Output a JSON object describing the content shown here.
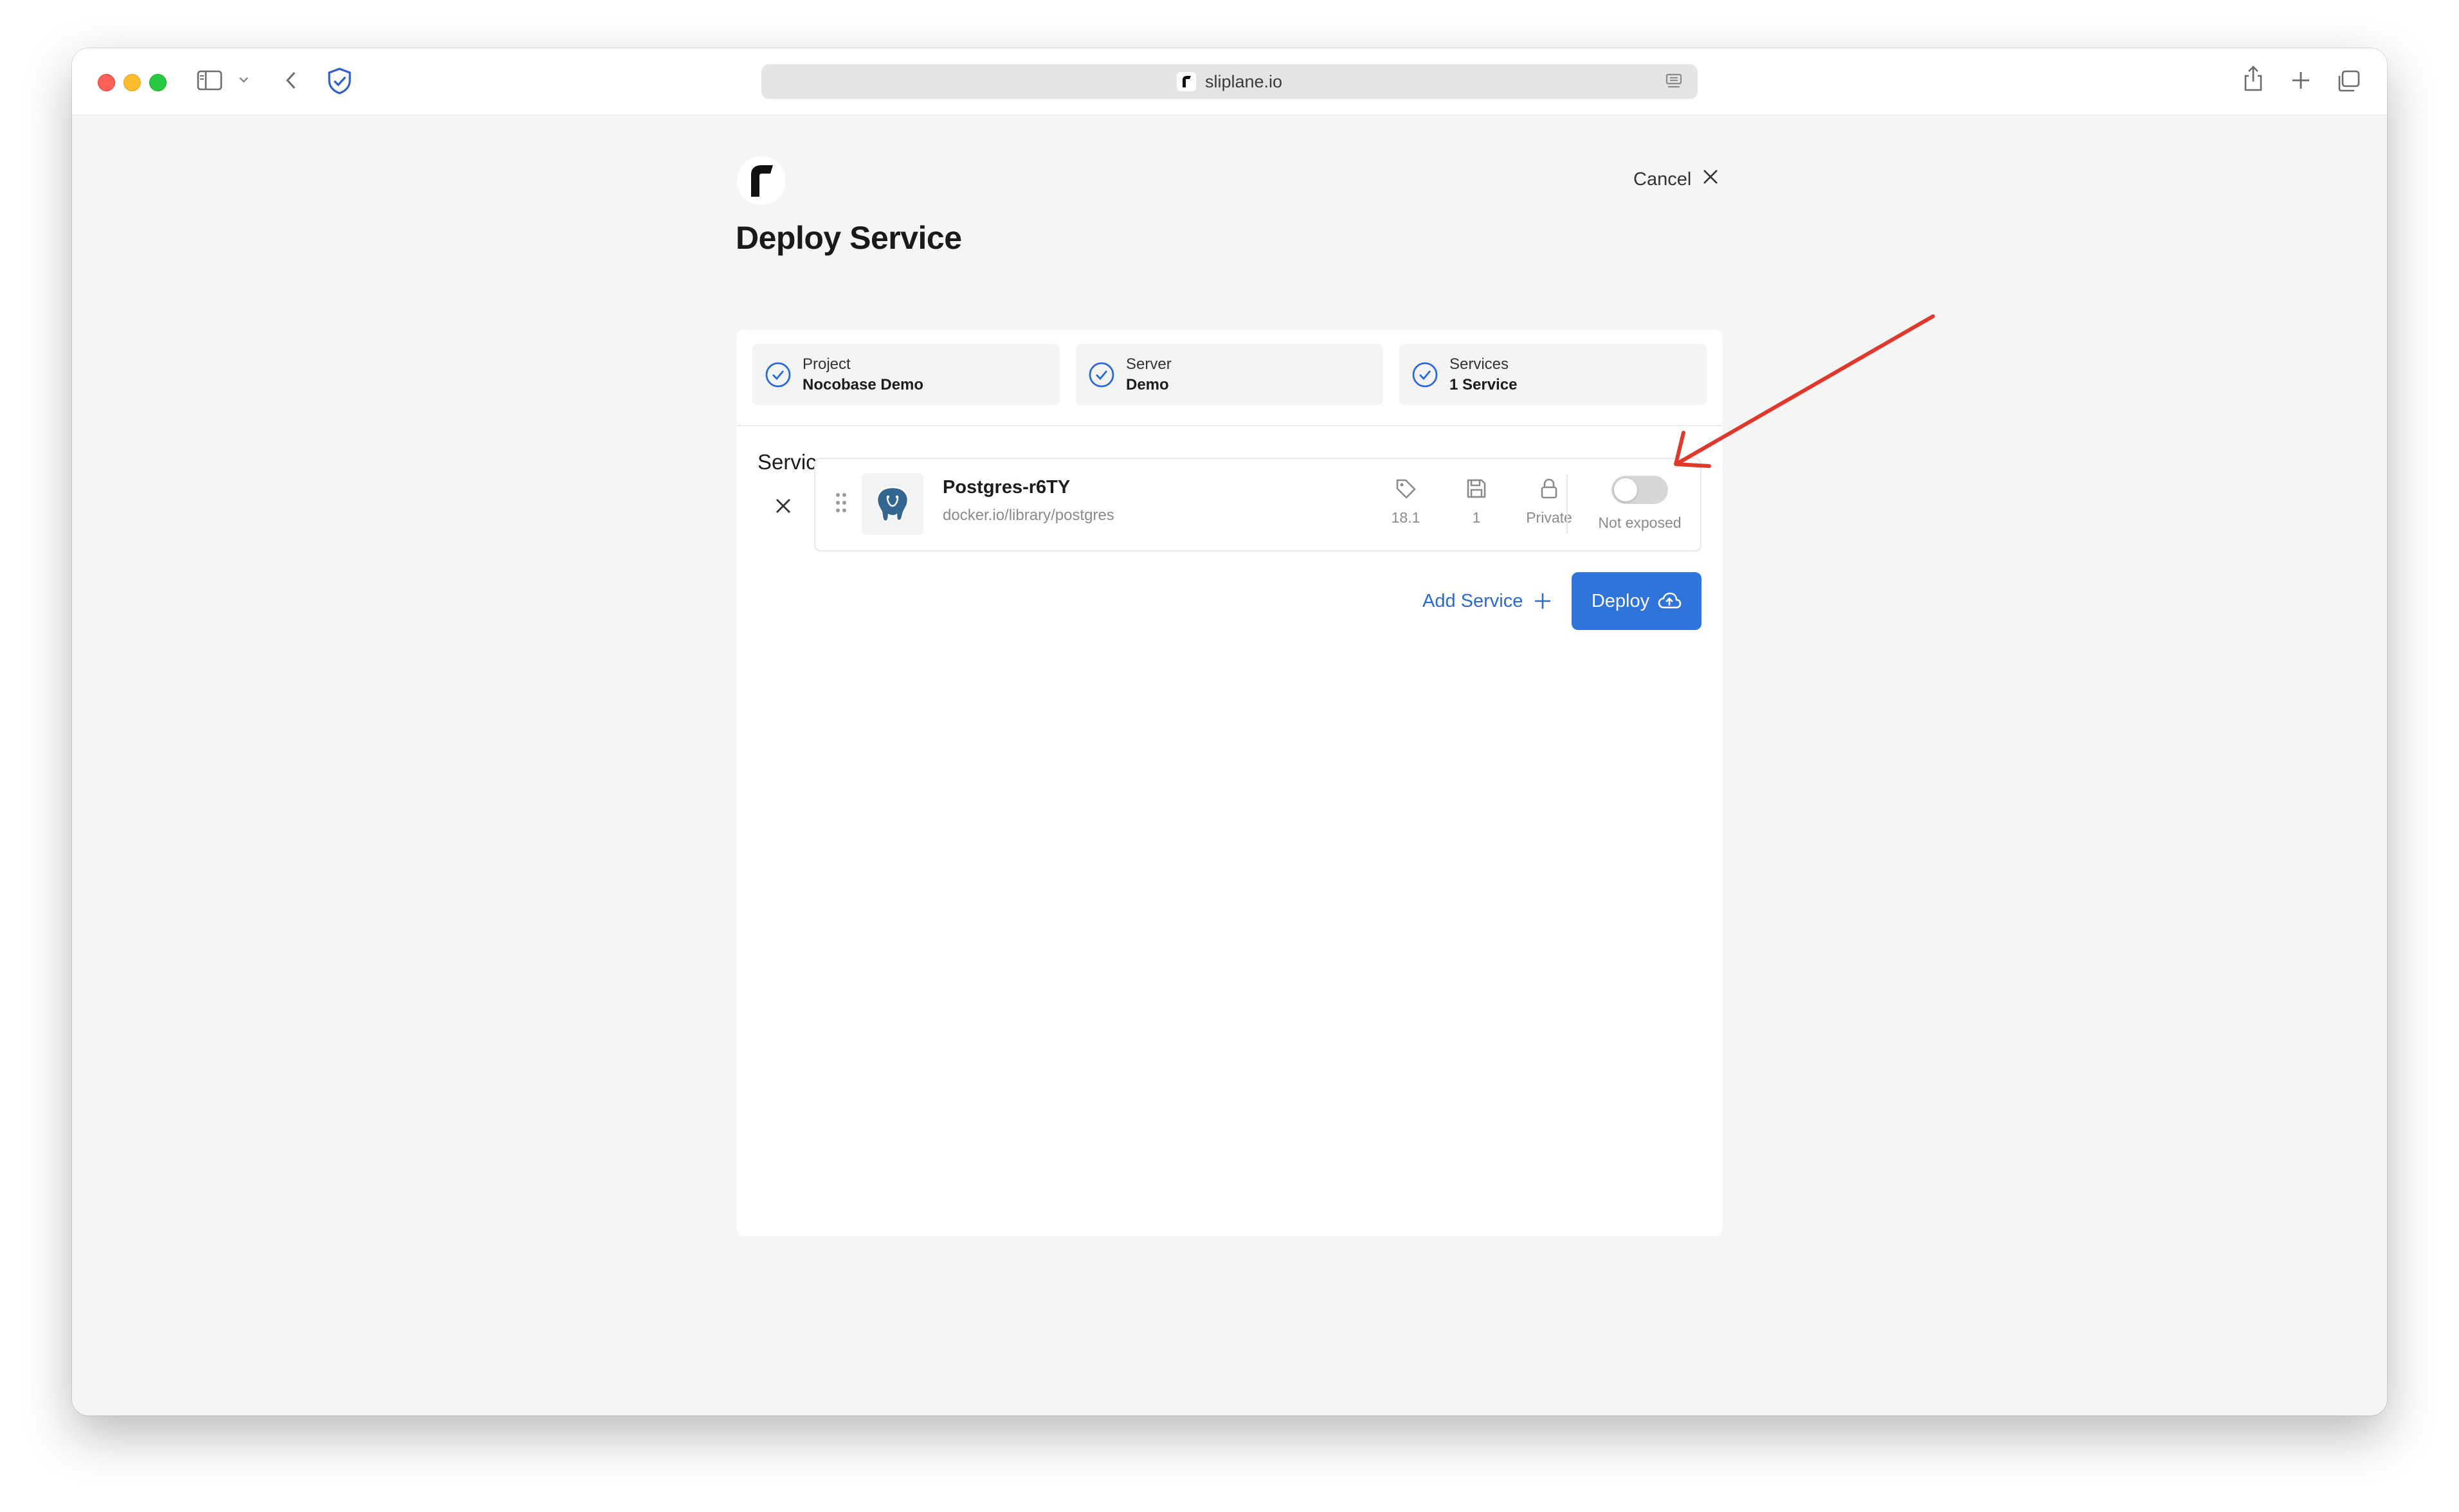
{
  "browser": {
    "url": "sliplane.io"
  },
  "header": {
    "title": "Deploy Service",
    "cancel_label": "Cancel"
  },
  "steps": [
    {
      "label": "Project",
      "value": "Nocobase Demo"
    },
    {
      "label": "Server",
      "value": "Demo"
    },
    {
      "label": "Services",
      "value": "1 Service"
    }
  ],
  "services_section": {
    "title": "Services",
    "items": [
      {
        "name": "Postgres-r6TY",
        "image": "docker.io/library/postgres",
        "version": "18.1",
        "volumes": "1",
        "visibility": "Private",
        "exposure_label": "Not exposed",
        "exposed": false
      }
    ]
  },
  "actions": {
    "add_service_label": "Add Service",
    "deploy_label": "Deploy"
  },
  "colors": {
    "accent": "#2f73db",
    "link": "#2a6ad6",
    "annotation": "#e0392b",
    "check": "#2a6ad6"
  }
}
